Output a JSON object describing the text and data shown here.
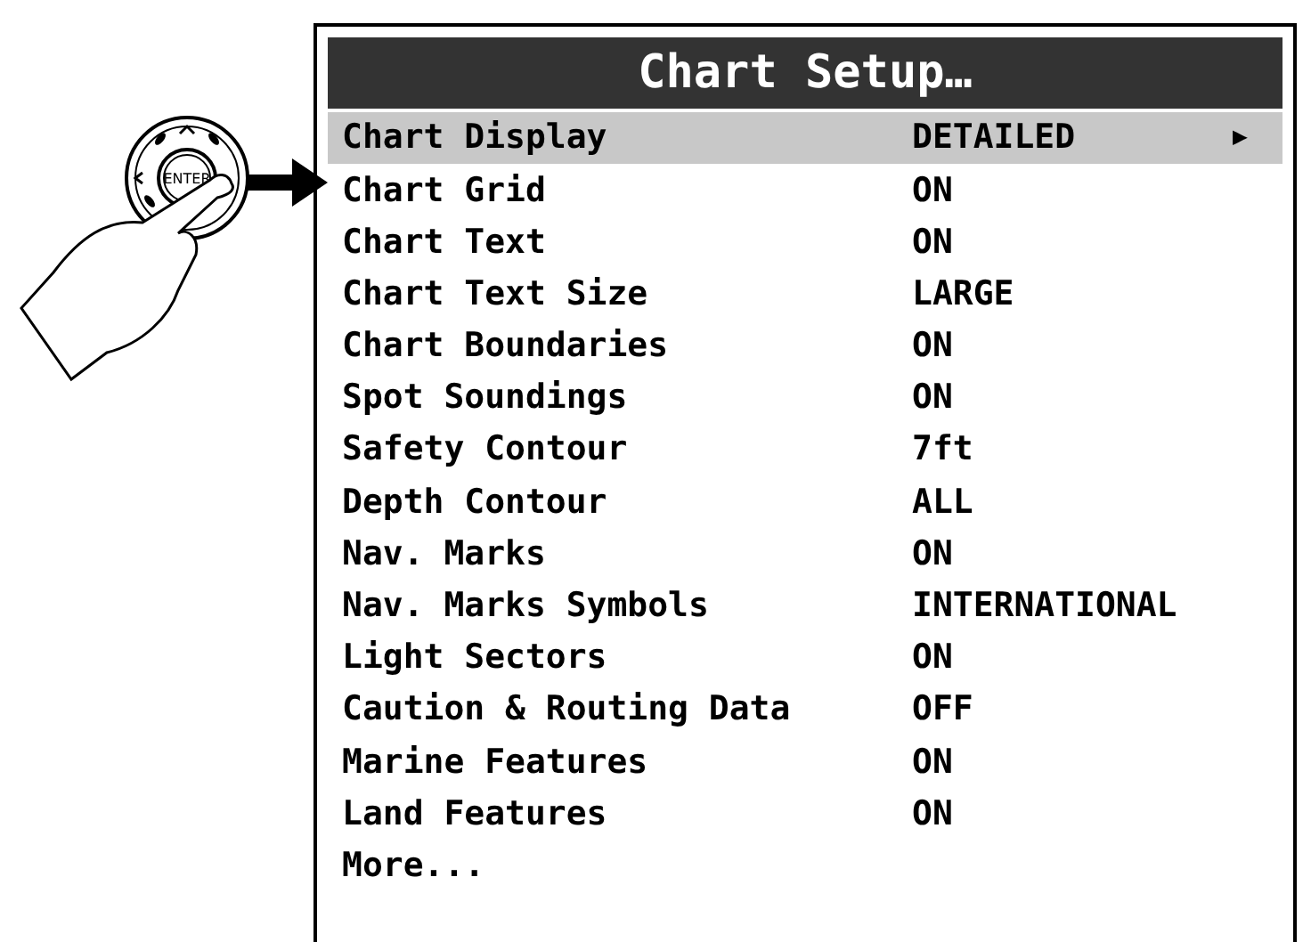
{
  "keypad": {
    "center_label": "ENTER"
  },
  "menu": {
    "title": "Chart Setup…",
    "items": [
      {
        "label": "Chart Display",
        "value": "DETAILED",
        "submenu": "▶",
        "selected": true
      },
      {
        "label": "Chart Grid",
        "value": "ON",
        "selected": false
      },
      {
        "label": "Chart Text",
        "value": "ON",
        "selected": false
      },
      {
        "label": "Chart Text Size",
        "value": "LARGE",
        "selected": false
      },
      {
        "label": "Chart Boundaries",
        "value": "ON",
        "selected": false
      },
      {
        "label": "Spot Soundings",
        "value": "ON",
        "selected": false
      },
      {
        "label": "Safety Contour",
        "value": "7ft",
        "selected": false
      },
      {
        "label": "Depth Contour",
        "value": "ALL",
        "selected": false
      },
      {
        "label": "Nav. Marks",
        "value": "ON",
        "selected": false
      },
      {
        "label": "Nav. Marks Symbols",
        "value": "INTERNATIONAL",
        "selected": false
      },
      {
        "label": "Light Sectors",
        "value": "ON",
        "selected": false
      },
      {
        "label": "Caution & Routing Data",
        "value": "OFF",
        "selected": false
      },
      {
        "label": "Marine Features",
        "value": "ON",
        "selected": false
      },
      {
        "label": "Land Features",
        "value": "ON",
        "selected": false
      },
      {
        "label": "More...",
        "selected": false
      }
    ]
  }
}
